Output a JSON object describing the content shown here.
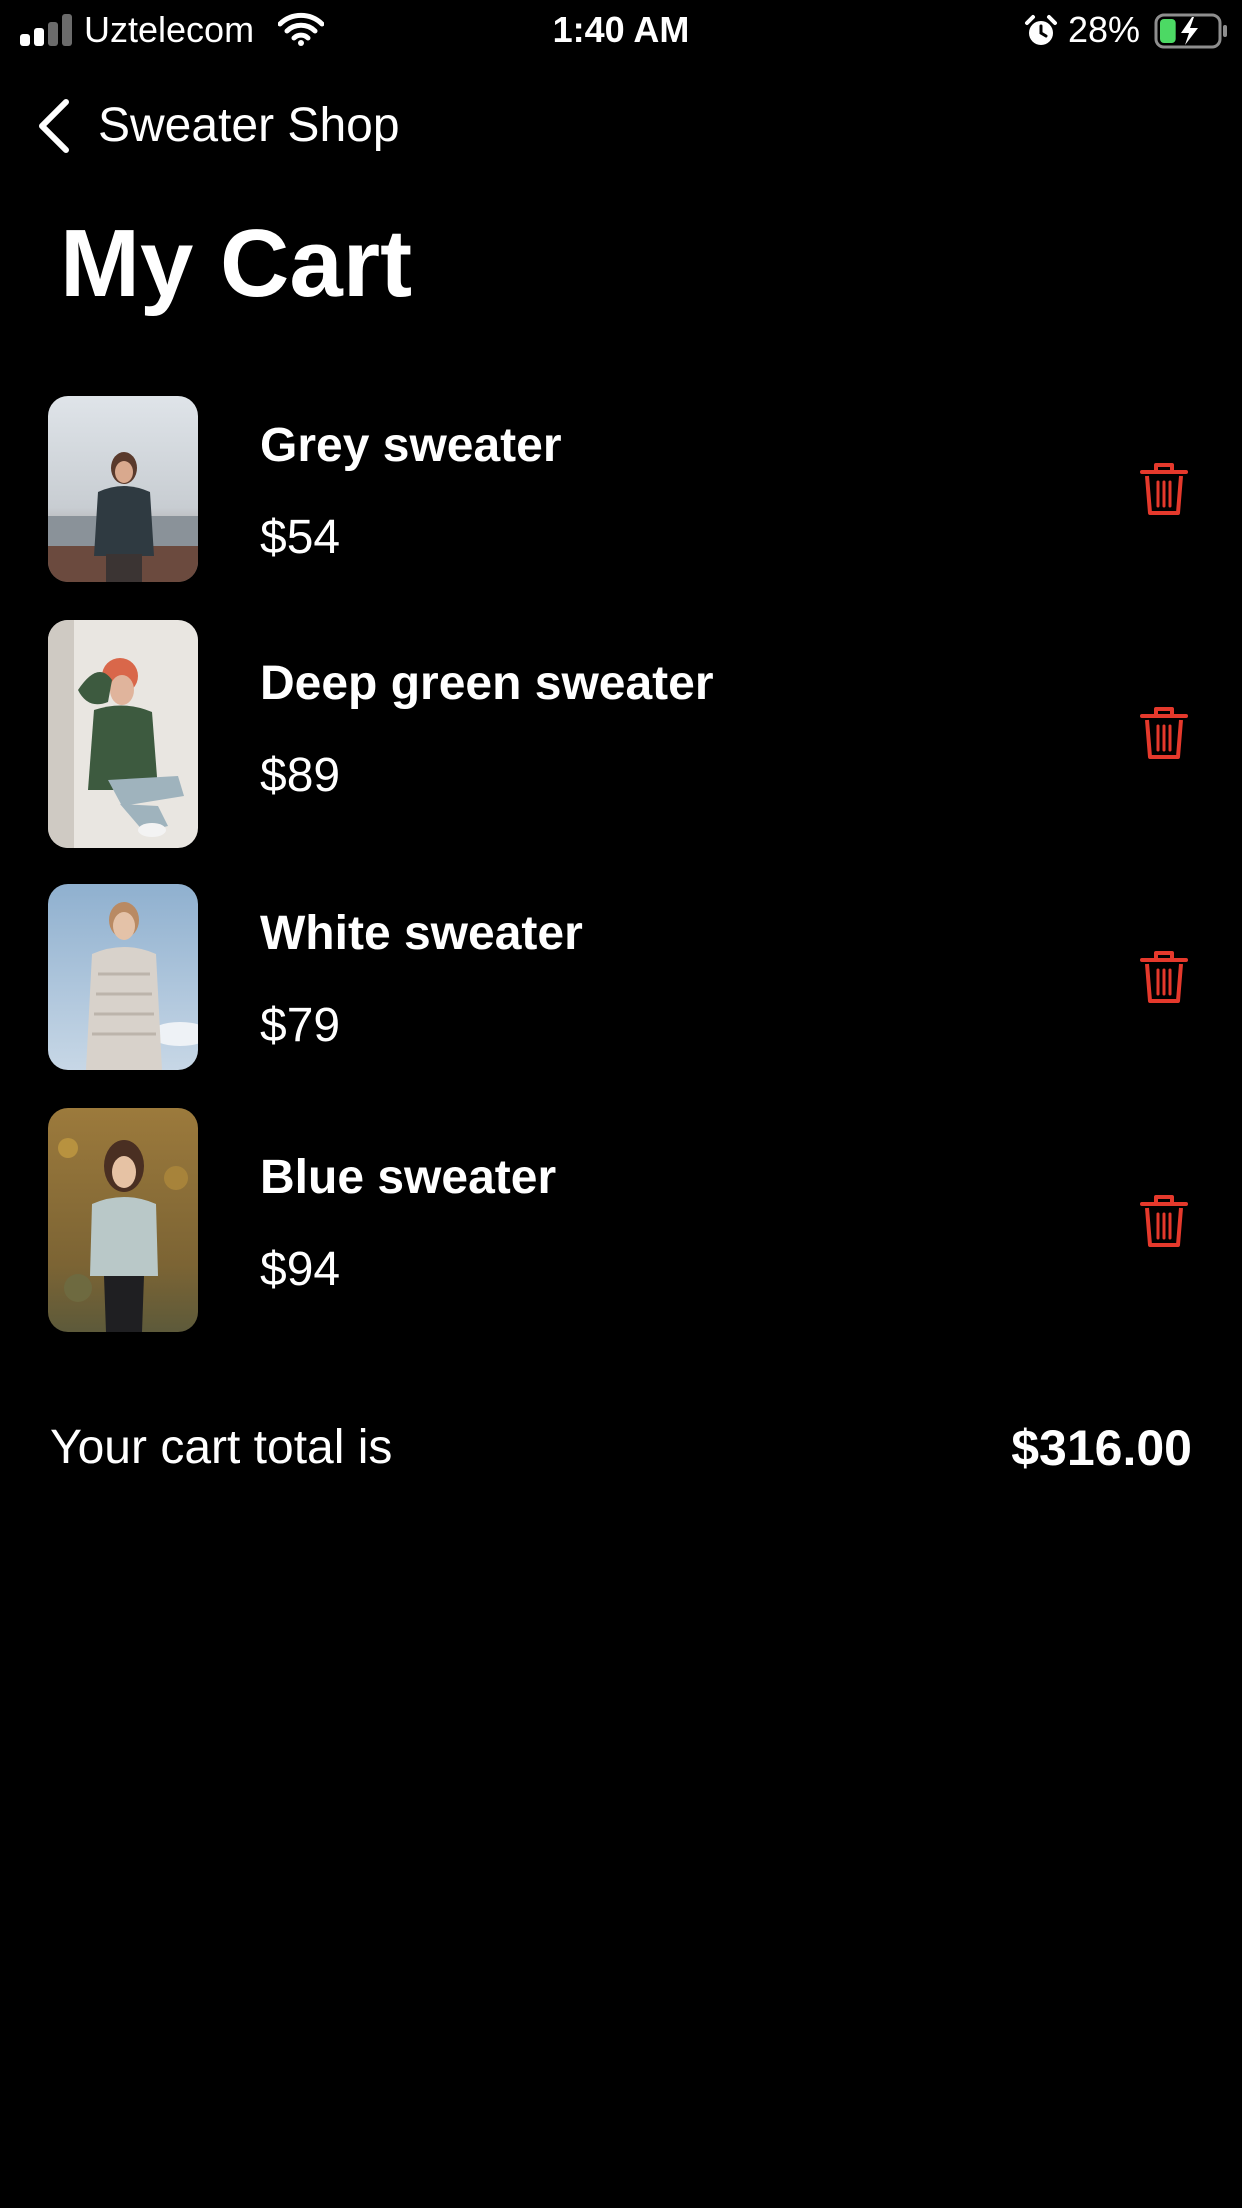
{
  "status_bar": {
    "carrier": "Uztelecom",
    "time": "1:40 AM",
    "battery_percent": "28%",
    "battery_level": 0.28,
    "icons": [
      "signal-icon",
      "wifi-icon",
      "alarm-icon",
      "battery-charging-icon"
    ]
  },
  "nav": {
    "back_label": "Sweater Shop",
    "back_icon": "chevron-left-icon"
  },
  "page": {
    "title": "My Cart"
  },
  "cart": {
    "items": [
      {
        "name": "Grey sweater",
        "price": "$54",
        "image": "product-photo",
        "delete_icon": "trash-icon"
      },
      {
        "name": "Deep green sweater",
        "price": "$89",
        "image": "product-photo",
        "delete_icon": "trash-icon"
      },
      {
        "name": "White sweater",
        "price": "$79",
        "image": "product-photo",
        "delete_icon": "trash-icon"
      },
      {
        "name": "Blue sweater",
        "price": "$94",
        "image": "product-photo",
        "delete_icon": "trash-icon"
      }
    ],
    "total_label": "Your cart total is",
    "total_value": "$316.00"
  },
  "colors": {
    "background": "#000000",
    "text": "#ffffff",
    "delete_accent": "#e5392c",
    "battery_fill": "#4cd964"
  }
}
